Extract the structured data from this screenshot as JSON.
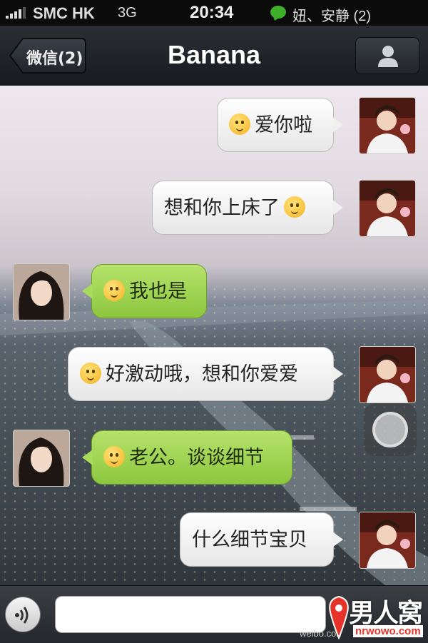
{
  "status_bar": {
    "carrier": "SMC HK",
    "network": "3G",
    "time": "20:34",
    "notification": "妞、安静 (2)",
    "notification_color": "#3fae2a"
  },
  "nav_bar": {
    "back_label": "微信(2)",
    "title": "Banana",
    "profile_icon": "person-icon"
  },
  "messages": [
    {
      "side": "right",
      "style": "white",
      "text": "爱你啦",
      "emoji_position": "before",
      "avatar": "boyfriend-avatar"
    },
    {
      "side": "right",
      "style": "white",
      "text": "想和你上床了",
      "emoji_position": "after",
      "avatar": "boyfriend-avatar"
    },
    {
      "side": "left",
      "style": "green",
      "text": "我也是",
      "emoji_position": "before",
      "avatar": "girlfriend-avatar"
    },
    {
      "side": "right",
      "style": "white",
      "text": "好激动哦，想和你爱爱",
      "emoji_position": "before",
      "avatar": "boyfriend-avatar"
    },
    {
      "side": "left",
      "style": "green",
      "text": "老公。谈谈细节",
      "emoji_position": "before",
      "avatar": "girlfriend-avatar"
    },
    {
      "side": "right",
      "style": "white",
      "text": "什么细节宝贝",
      "emoji_position": "none",
      "avatar": "boyfriend-avatar"
    }
  ],
  "input_bar": {
    "voice_icon": "voice-wave-icon",
    "text_value": ""
  },
  "watermark": {
    "weibo": "weibo.con",
    "logo_cn": "男人窝",
    "logo_en": "nrwowo.com"
  },
  "colors": {
    "green_bubble": "#8cc63f",
    "white_bubble": "#f0f0f0",
    "nav_bg": "#1f2227"
  }
}
